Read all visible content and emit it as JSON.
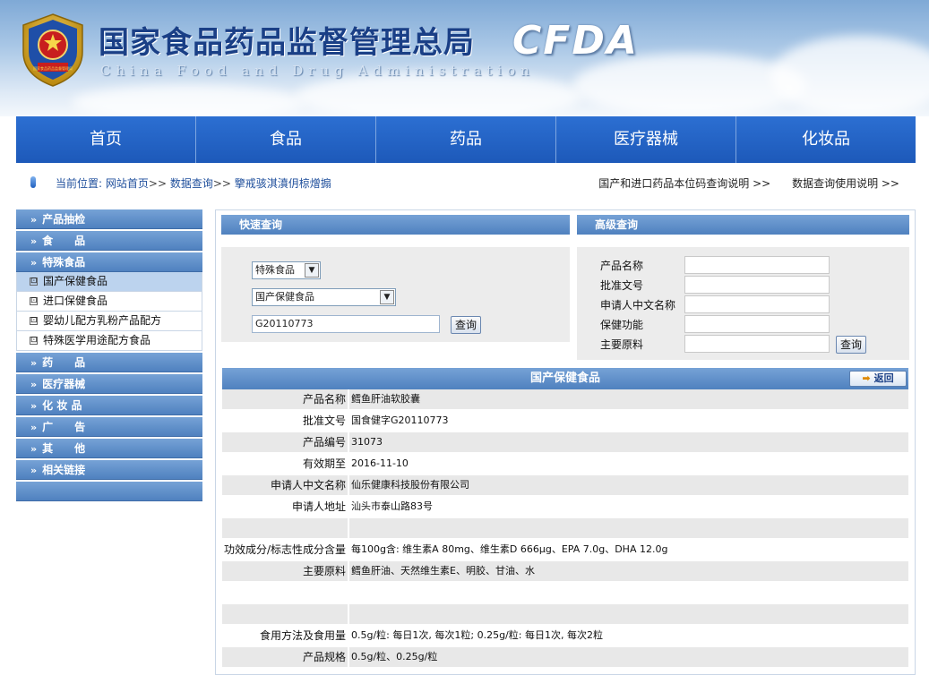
{
  "header": {
    "title": "国家食品药品监督管理总局",
    "subtitle": "China Food and Drug Administration",
    "logo": "CFDA",
    "emblem_text": "国家食品药品监督管理局"
  },
  "nav": [
    "首页",
    "食品",
    "药品",
    "医疗器械",
    "化妆品"
  ],
  "breadcrumb": {
    "prefix": "当前位置:",
    "home": "网站首页",
    "sep1": ">>",
    "query": "数据查询",
    "sep2": ">>",
    "current": "擥戒骇淇濆仴椋熷搧"
  },
  "top_links": [
    "国产和进口药品本位码查询说明 >>",
    "数据查询使用说明 >>"
  ],
  "sidebar": {
    "items": [
      {
        "label": "产品抽检",
        "type": "head"
      },
      {
        "label": "食　　品",
        "type": "head"
      },
      {
        "label": "特殊食品",
        "type": "head"
      },
      {
        "label": "国产保健食品",
        "type": "sub",
        "active": true
      },
      {
        "label": "进口保健食品",
        "type": "sub"
      },
      {
        "label": "婴幼儿配方乳粉产品配方",
        "type": "sub"
      },
      {
        "label": "特殊医学用途配方食品",
        "type": "sub"
      },
      {
        "label": "药　　品",
        "type": "head"
      },
      {
        "label": "医疗器械",
        "type": "head"
      },
      {
        "label": "化 妆 品",
        "type": "head"
      },
      {
        "label": "广　　告",
        "type": "head"
      },
      {
        "label": "其　　他",
        "type": "head"
      },
      {
        "label": "相关链接",
        "type": "head"
      }
    ],
    "box_glyph": "⊡"
  },
  "quick_search": {
    "title": "快速查询",
    "category": "特殊食品",
    "subcategory": "国产保健食品",
    "keyword": "G20110773",
    "button": "查询"
  },
  "advanced_search": {
    "title": "高级查询",
    "fields": [
      "产品名称",
      "批准文号",
      "申请人中文名称",
      "保健功能",
      "主要原料"
    ],
    "button": "查询"
  },
  "detail": {
    "title": "国产保健食品",
    "back": "返回",
    "rows": [
      {
        "k": "产品名称",
        "v": "鳕鱼肝油软胶囊"
      },
      {
        "k": "批准文号",
        "v": "国食健字G20110773"
      },
      {
        "k": "产品编号",
        "v": "31073"
      },
      {
        "k": "有效期至",
        "v": "2016-11-10"
      },
      {
        "k": "申请人中文名称",
        "v": "仙乐健康科技股份有限公司"
      },
      {
        "k": "申请人地址",
        "v": "汕头市泰山路83号"
      },
      {
        "k": "",
        "v": ""
      },
      {
        "k": "功效成分/标志性成分含量",
        "v": "每100g含: 维生素A 80mg、维生素D 666μg、EPA 7.0g、DHA 12.0g"
      },
      {
        "k": "主要原料",
        "v": "鳕鱼肝油、天然维生素E、明胶、甘油、水"
      },
      {
        "k": "",
        "v": ""
      },
      {
        "k": "",
        "v": ""
      },
      {
        "k": "食用方法及食用量",
        "v": "0.5g/粒: 每日1次, 每次1粒; 0.25g/粒: 每日1次, 每次2粒"
      },
      {
        "k": "产品规格",
        "v": "0.5g/粒、0.25g/粒"
      }
    ]
  },
  "colors": {
    "nav": "#1f5fbf",
    "section_head": "#5b8cc7",
    "row_alt": "#e8e8e8"
  }
}
